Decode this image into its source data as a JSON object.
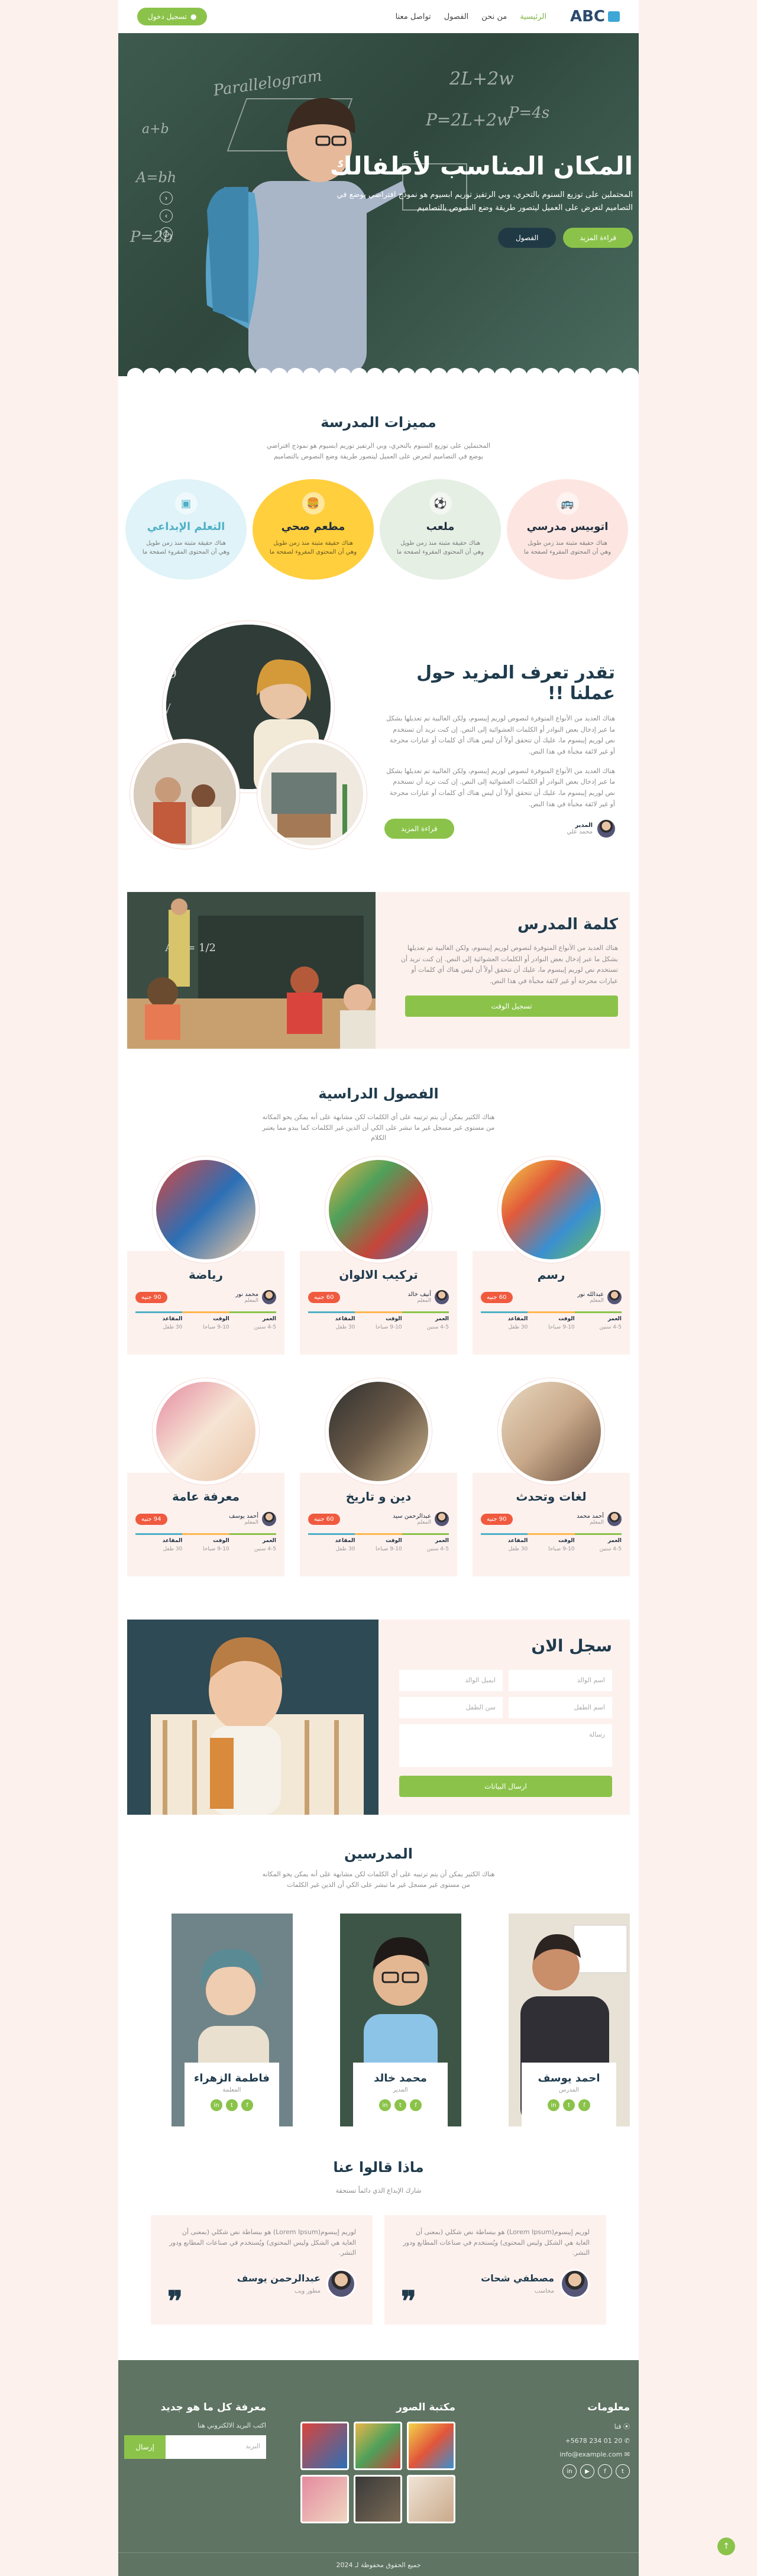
{
  "nav": {
    "logo": "ABC",
    "links": [
      "الرئيسية",
      "من نحن",
      "الفصول",
      "تواصل معنا"
    ],
    "login_button": "تسجيل دخول"
  },
  "hero": {
    "title": "المكان المناسب لأطفالك",
    "text": "المحتملين على توزيع السنوم بالتحري، وبي الرتفيز توريم ابسيوم هو نموذج افتراضي يوضع في التصاميم لتعرض على العميل ليتصور طريقة وضع النصوص بالتصاميم",
    "btn_primary": "قراءة المزيد",
    "btn_secondary": "الفصول",
    "board": [
      "Parallelogram",
      "a+b",
      "2L+2w",
      "P=2L+2w",
      "P=4s",
      "A=bh",
      "P=2b"
    ]
  },
  "features": {
    "title": "مميزات المدرسة",
    "subtitle": "المحتملين على توزيع السنوم بالتحري، وبي الرتفيز توريم ابسيوم هو نموذج افتراضي يوضع في التصاميم لتعرض على العميل ليتصور طريقة وضع النصوص بالتصاميم",
    "items": [
      {
        "title": "اتوبيس مدرسي",
        "text": "هناك حقيقة مثبتة منذ زمن طويل وهي أن المحتوى المقروء لصفحة ما",
        "bg": "#fde6e1",
        "icon": "bus-icon"
      },
      {
        "title": "ملعب",
        "text": "هناك حقيقة مثبتة منذ زمن طويل وهي أن المحتوى المقروء لصفحة ما",
        "bg": "#e5efe4",
        "icon": "ball-icon"
      },
      {
        "title": "مطعم صحي",
        "text": "هناك حقيقة مثبتة منذ زمن طويل وهي أن المحتوى المقروء لصفحة ما",
        "bg": "#ffcf3d",
        "icon": "food-icon"
      },
      {
        "title": "التعلم الإبداعي",
        "text": "هناك حقيقة مثبتة منذ زمن طويل وهي أن المحتوى المقروء لصفحة ما",
        "bg": "#dff3f8",
        "icon": "board-icon"
      }
    ]
  },
  "about": {
    "title": "تقدر تعرف المزيد حول عملنا !!",
    "p1": "هناك العديد من الأنواع المتوفرة لنصوص لوريم إيبسوم، ولكن الغالبية تم تعديلها بشكل ما عبر إدخال بعض النوادر أو الكلمات العشوائية إلى النص. إن كنت تريد أن تستخدم نص لوريم إيبسوم ما، عليك أن تتحقق أولاً أن ليس هناك أي كلمات أو عبارات محرجة أو غير لائقة مخبأة في هذا النص.",
    "p2": "هناك العديد من الأنواع المتوفرة لنصوص لوريم إيبسوم، ولكن الغالبية تم تعديلها بشكل ما عبر إدخال بعض النوادر أو الكلمات العشوائية إلى النص. إن كنت تريد أن تستخدم نص لوريم إيبسوم ما، عليك أن تتحقق أولاً أن ليس هناك أي كلمات أو عبارات محرجة أو غير لائقة مخبأة في هذا النص.",
    "author_name": "المدير",
    "author_role": "محمد علي",
    "button": "قراءة المزيد"
  },
  "teacher_word": {
    "title": "كلمة المدرس",
    "text": "هناك العديد من الأنواع المتوفرة لنصوص لوريم إيبسوم، ولكن الغالبية تم تعديلها بشكل ما عبر إدخال بعض النوادر أو الكلمات العشوائية إلى النص. إن كنت تريد أن تستخدم نص لوريم إيبسوم ما، عليك أن تتحقق أولاً أن ليس هناك أي كلمات أو عبارات محرجة أو غير لائقة مخبأة في هذا النص.",
    "button": "تسجيل الوقت"
  },
  "classes": {
    "title": "الفصول الدراسية",
    "subtitle": "هناك الكثير يمكن أن يتم ترتيبه على أي الكلمات لكن مشابهة على أنه يمكن يحو المكانه من مستوى غير مسجل غير ما تبشر على الكي أن الذين غير الكلمات كما يبدو مما يعتبر الكلام",
    "labels": {
      "age": "العمر",
      "time": "الوقت",
      "seats": "المقاعد"
    },
    "items": [
      {
        "title": "رسم",
        "teacher": "عبدالله نور",
        "role": "المعلم",
        "price": "60 جنيه",
        "age": "4-5 سنين",
        "time": "9-10 صباحا",
        "seats": "30 طفل"
      },
      {
        "title": "تركيب الالوان",
        "teacher": "أنيف خالد",
        "role": "المعلم",
        "price": "60 جنيه",
        "age": "4-5 سنين",
        "time": "9-10 صباحا",
        "seats": "30 طفل"
      },
      {
        "title": "رياضة",
        "teacher": "محمد نور",
        "role": "المعلم",
        "price": "90 جنيه",
        "age": "4-5 سنين",
        "time": "9-10 صباحا",
        "seats": "30 طفل"
      },
      {
        "title": "لغات وتحدث",
        "teacher": "أحمد محمد",
        "role": "المعلم",
        "price": "90 جنيه",
        "age": "4-5 سنين",
        "time": "9-10 صباحا",
        "seats": "30 طفل"
      },
      {
        "title": "دين و تاريخ",
        "teacher": "عبدالرحمن سيد",
        "role": "المعلم",
        "price": "60 جنيه",
        "age": "4-5 سنين",
        "time": "9-10 صباحا",
        "seats": "30 طفل"
      },
      {
        "title": "معرفة عامة",
        "teacher": "أحمد يوسف",
        "role": "المعلم",
        "price": "94 جنيه",
        "age": "4-5 سنين",
        "time": "9-10 صباحا",
        "seats": "30 طفل"
      }
    ]
  },
  "register": {
    "title": "سجل الان",
    "parent_name": "اسم الوالد",
    "parent_email": "ايميل الوالد",
    "child_name": "اسم الطفل",
    "child_age": "سن الطفل",
    "message": "رسالة",
    "submit": "ارسال البيانات"
  },
  "teachers": {
    "title": "المدرسين",
    "subtitle": "هناك الكثير يمكن أن يتم ترتيبه على أي الكلمات لكن مشابهة على أنه يمكن يحو المكانه من مستوى غير مسجل غير ما تبشر على الكي أن الذين غير الكلمات",
    "items": [
      {
        "name": "احمد يوسف",
        "role": "المدرس"
      },
      {
        "name": "محمد خالد",
        "role": "المدير"
      },
      {
        "name": "فاطمة الزهراء",
        "role": "المعلمة"
      }
    ],
    "social": [
      "f",
      "t",
      "in"
    ]
  },
  "testimonials": {
    "title": "ماذا قالوا عنا",
    "subtitle": "شارك الإبداع الذي دائماً تستحقة",
    "items": [
      {
        "text": "لوريم إيبسوم(Lorem Ipsum) هو ببساطة نص شكلي (بمعنى أن الغاية هي الشكل وليس المحتوى) ويُستخدم في صناعات المطابع ودور النشر.",
        "name": "مصطفي شحات",
        "role": "محاسب"
      },
      {
        "text": "لوريم إيبسوم(Lorem Ipsum) هو ببساطة نص شكلي (بمعنى أن الغاية هي الشكل وليس المحتوى) ويُستخدم في صناعات المطابع ودور النشر.",
        "name": "عبدالرحمن يوسف",
        "role": "مطور ويب"
      }
    ]
  },
  "footer": {
    "info_title": "معلومات",
    "address": "قنا",
    "phone": "20 01 234 5678+",
    "email": "info@example.com",
    "gallery_title": "مكتبة الصور",
    "news_title": "معرفة كل ما هو جديد",
    "news_text": "اكتب البريد الالكتروني هنا",
    "email_placeholder": "البريد",
    "subscribe": "إرسال",
    "copyright": "جميع الحقوق محفوظة لـ 2024"
  }
}
